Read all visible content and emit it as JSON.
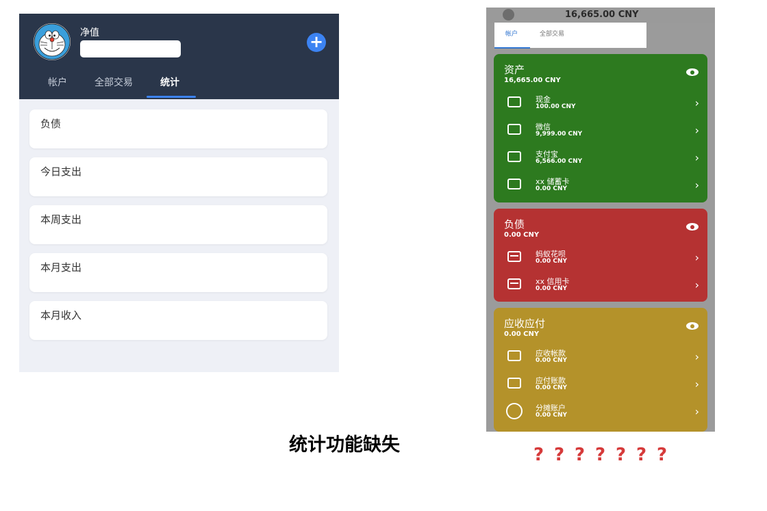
{
  "left_screen": {
    "net_label": "净值",
    "tabs": [
      "帐户",
      "全部交易",
      "统计"
    ],
    "active_tab_index": 2,
    "stat_cards": [
      "负债",
      "今日支出",
      "本周支出",
      "本月支出",
      "本月收入"
    ],
    "add_icon": "plus-icon",
    "avatar_icon": "doraemon-avatar"
  },
  "caption": "统计功能缺失",
  "right_screen": {
    "total": "16,665.00 CNY",
    "tabs": [
      "帐户",
      "全部交易"
    ],
    "active_tab_index": 0,
    "groups": [
      {
        "title": "资产",
        "total": "16,665.00 CNY",
        "color": "#2d7a1f",
        "items": [
          {
            "name": "现金",
            "amount": "100.00 CNY",
            "icon": "cash-icon"
          },
          {
            "name": "微信",
            "amount": "9,999.00 CNY",
            "icon": "wallet-icon"
          },
          {
            "name": "支付宝",
            "amount": "6,566.00 CNY",
            "icon": "wallet-icon"
          },
          {
            "name": "xx 储蓄卡",
            "amount": "0.00 CNY",
            "icon": "wallet-icon"
          }
        ]
      },
      {
        "title": "负债",
        "total": "0.00 CNY",
        "color": "#b53232",
        "items": [
          {
            "name": "蚂蚁花呗",
            "amount": "0.00 CNY",
            "icon": "credit-card-icon"
          },
          {
            "name": "xx 信用卡",
            "amount": "0.00 CNY",
            "icon": "credit-card-icon"
          }
        ]
      },
      {
        "title": "应收应付",
        "total": "0.00 CNY",
        "color": "#b4922a",
        "items": [
          {
            "name": "应收帐款",
            "amount": "0.00 CNY",
            "icon": "wallet-icon"
          },
          {
            "name": "应付账款",
            "amount": "0.00 CNY",
            "icon": "wallet-icon"
          },
          {
            "name": "分摊账户",
            "amount": "0.00 CNY",
            "icon": "compass-icon"
          }
        ]
      }
    ]
  },
  "question_marks": [
    "?",
    "?",
    "?",
    "?",
    "?",
    "?",
    "?"
  ],
  "colors": {
    "header_bg": "#2a364a",
    "accent_blue": "#3c83f2",
    "question_red": "#d63a3a"
  }
}
